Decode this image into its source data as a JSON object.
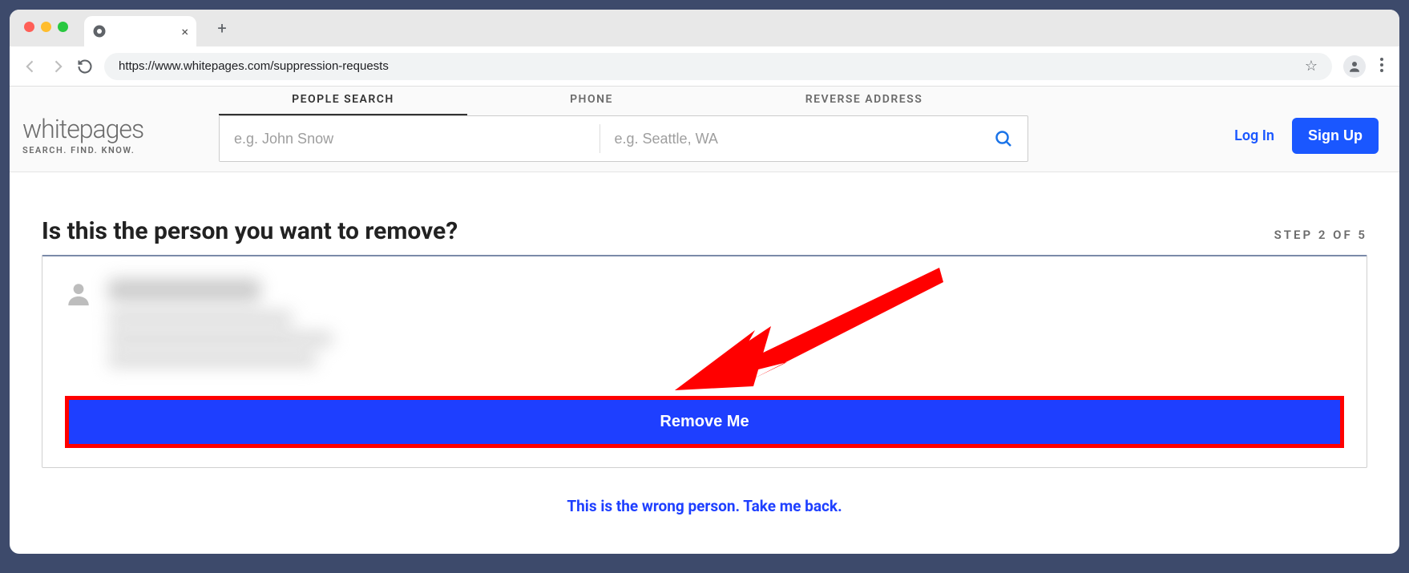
{
  "browser": {
    "url": "https://www.whitepages.com/suppression-requests"
  },
  "site": {
    "logo": "whitepages",
    "tagline": "SEARCH. FIND. KNOW.",
    "tabs": {
      "people": "PEOPLE SEARCH",
      "phone": "PHONE",
      "address": "REVERSE ADDRESS"
    },
    "search": {
      "name_placeholder": "e.g. John Snow",
      "location_placeholder": "e.g. Seattle, WA"
    },
    "auth": {
      "login": "Log In",
      "signup": "Sign Up"
    }
  },
  "page": {
    "headline": "Is this the person you want to remove?",
    "step_label": "STEP 2 OF 5",
    "remove_button": "Remove Me",
    "wrong_person": "This is the wrong person. Take me back."
  }
}
